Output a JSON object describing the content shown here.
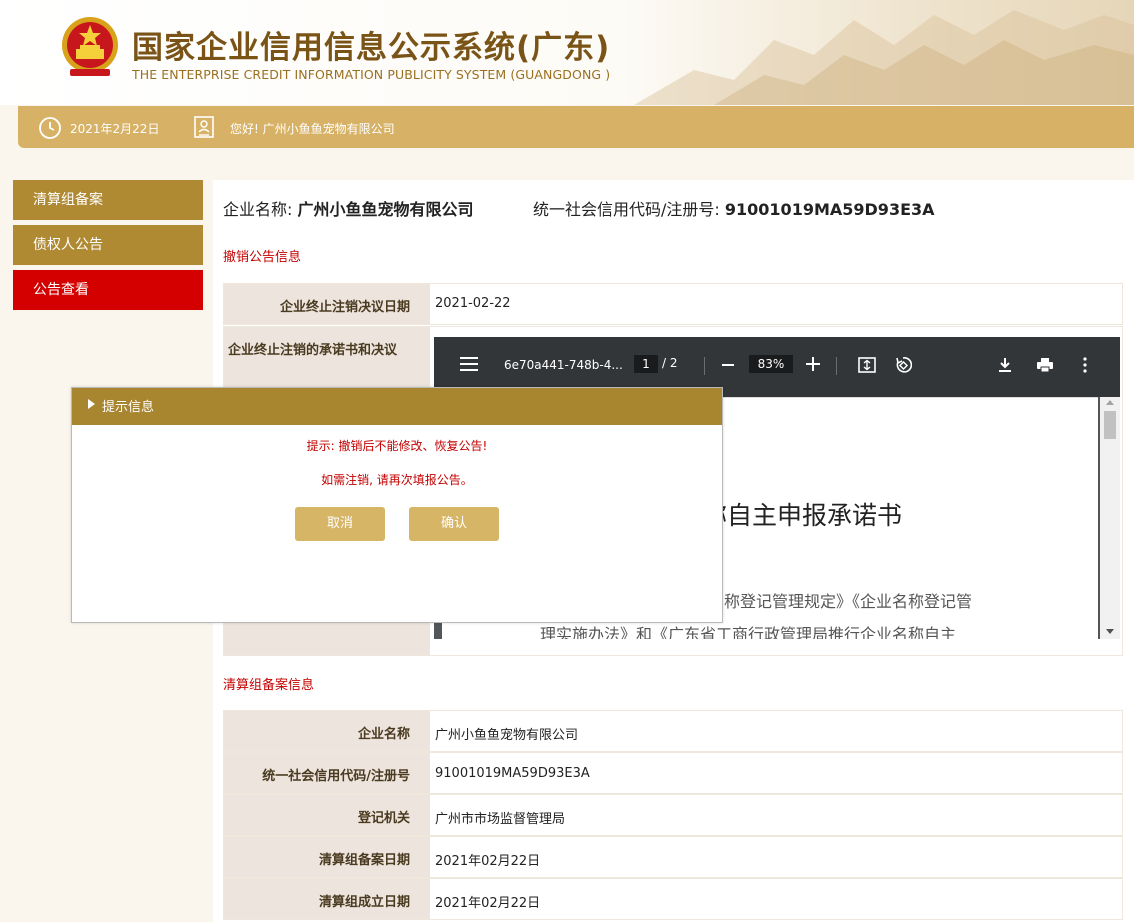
{
  "header": {
    "title": "国家企业信用信息公示系统(广东)",
    "subtitle": "THE ENTERPRISE CREDIT INFORMATION PUBLICITY SYSTEM (GUANGDONG )"
  },
  "infobar": {
    "date": "2021年2月22日",
    "greeting": "您好! 广州小鱼鱼宠物有限公司"
  },
  "sidebar": {
    "items": [
      {
        "label": "清算组备案"
      },
      {
        "label": "债权人公告"
      },
      {
        "label": "公告查看"
      }
    ]
  },
  "content": {
    "ent_name_label": "企业名称:",
    "ent_name": "广州小鱼鱼宠物有限公司",
    "code_label": "统一社会信用代码/注册号:",
    "code": "91001019MA59D93E3A",
    "revoke_section": "撤销公告信息",
    "revoke_rows": [
      {
        "label": "企业终止注销决议日期",
        "value": "2021-02-22"
      },
      {
        "label": "企业终止注销的承诺书和决议",
        "value": ""
      }
    ],
    "filing_section": "清算组备案信息",
    "filing_rows": [
      {
        "label": "企业名称",
        "value": "广州小鱼鱼宠物有限公司"
      },
      {
        "label": "统一社会信用代码/注册号",
        "value": "91001019MA59D93E3A"
      },
      {
        "label": "登记机关",
        "value": "广州市市场监督管理局"
      },
      {
        "label": "清算组备案日期",
        "value": "2021年02月22日"
      },
      {
        "label": "清算组成立日期",
        "value": "2021年02月22日"
      }
    ]
  },
  "pdf": {
    "filename": "6e70a441-748b-4...",
    "page": "1",
    "page_total": "/ 2",
    "zoom": "83%",
    "heading": "称自主申报承诺书",
    "line1": "称登记管理规定》《企业名称登记管",
    "line2": "理实施办法》和《广东省工商行政管理局推行企业名称自主"
  },
  "dialog": {
    "title": "提示信息",
    "msg1": "提示: 撤销后不能修改、恢复公告!",
    "msg2": "如需注销, 请再次填报公告。",
    "cancel": "取消",
    "confirm": "确认"
  },
  "colors": {
    "gold": "#b08a33",
    "bar_gold": "#d7b266",
    "accent_red": "#d40000",
    "dialog_head": "#a8852f",
    "button": "#d6b566"
  }
}
